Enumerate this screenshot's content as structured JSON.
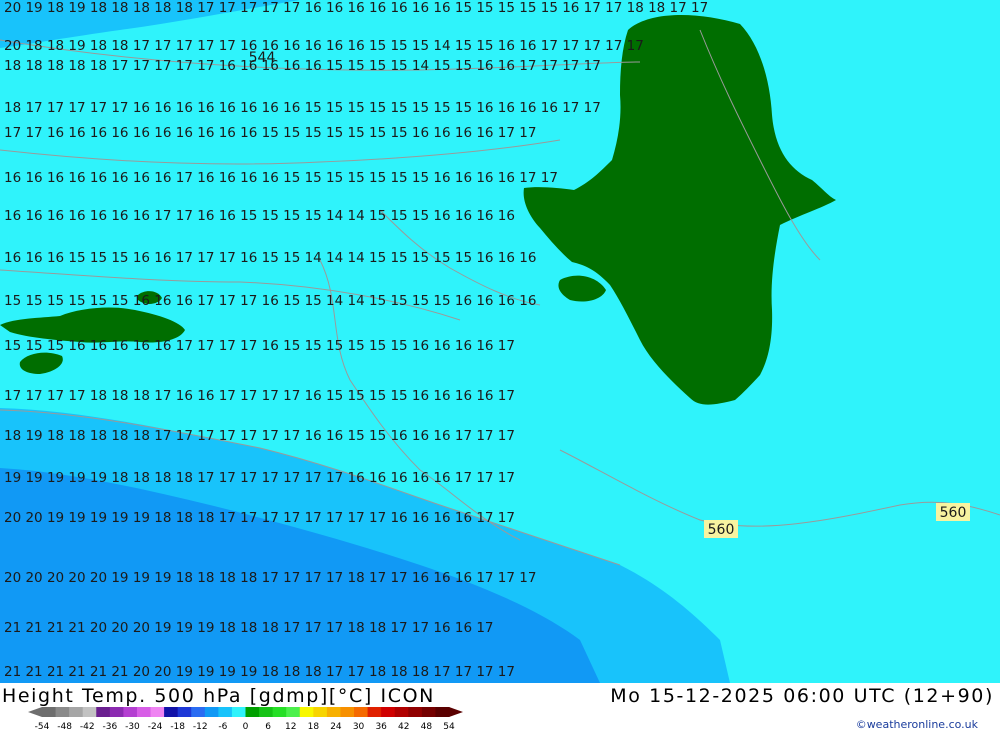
{
  "map": {
    "title_left": "Height Temp. 500 hPa [gdmp][°C] ICON",
    "title_right": "Mo 15-12-2025 06:00 UTC (12+90)",
    "credit": "©weatheronline.co.uk",
    "contour_labels": [
      "544",
      "560",
      "560"
    ],
    "temperature_labels_rows": [
      "20 19 18 19 18 18 18 18 18 17 17 17 17 17 16 16 16 16 16 16 16 15 15 15 15 15 16 17 17 18 18 17 17",
      "20 18 18 19 18 18 17 17 17 17 17 16 16 16 16 16 16 15 15 15 14 15 15 16 16 17 17 17 17 17",
      "18 18 18 18 18 17 17 17 17 17 16 16 16 16 16 15 15 15 15 14 15 15 16 16 17 17 17 17",
      "18 17 17 17 17 17 16 16 16 16 16 16 16 16 15 15 15 15 15 15 15 15 16 16 16 16 17 17",
      "17 17 16 16 16 16 16 16 16 16 16 16 15 15 15 15 15 15 15 16 16 16 16 17 17",
      "16 16 16 16 16 16 16 16 17 16 16 16 16 15 15 15 15 15 15 15 16 16 16 16 17 17",
      "16 16 16 16 16 16 16 17 17 16 16 15 15 15 15 14 14 15 15 15 16 16 16 16",
      "16 16 16 15 15 15 16 16 17 17 17 16 15 15 14 14 14 15 15 15 15 15 16 16 16",
      "15 15 15 15 15 15 16 16 16 17 17 17 16 15 15 14 14 15 15 15 15 16 16 16 16",
      "15 15 15 16 16 16 16 16 17 17 17 17 16 15 15 15 15 15 15 16 16 16 16 17",
      "17 17 17 17 18 18 18 17 16 16 17 17 17 17 16 15 15 15 15 16 16 16 16 17",
      "18 19 18 18 18 18 18 17 17 17 17 17 17 17 16 16 15 15 16 16 16 17 17 17",
      "19 19 19 19 19 18 18 18 18 17 17 17 17 17 17 17 16 16 16 16 16 17 17 17",
      "20 20 19 19 19 19 19 18 18 18 17 17 17 17 17 17 17 17 16 16 16 16 17 17",
      "20 20 20 20 20 19 19 19 18 18 18 18 17 17 17 17 18 17 17 16 16 16 17 17 17",
      "21 21 21 21 20 20 20 19 19 19 18 18 18 17 17 17 18 18 17 17 16 16 17",
      "21 21 21 21 21 21 20 20 19 19 19 19 18 18 18 17 17 18 18 18 17 17 17 17"
    ],
    "colors": {
      "land_cold_cyan": "#2ff3fb",
      "cold_blue_1": "#18c3fb",
      "cold_blue_2": "#1199f5",
      "warm_green": "#006e00",
      "contour_line": "#9a9a9a",
      "label_text": "#1a1a1a"
    }
  },
  "legend": {
    "ticks": [
      "-54",
      "-48",
      "-42",
      "-36",
      "-30",
      "-24",
      "-18",
      "-12",
      "-6",
      "0",
      "6",
      "12",
      "18",
      "24",
      "30",
      "36",
      "42",
      "48",
      "54"
    ],
    "colors": [
      "#6e6e6e",
      "#8a8a8a",
      "#a6a6a6",
      "#c2c2c2",
      "#6a1f8f",
      "#8c2bb1",
      "#b43fd1",
      "#d75ee6",
      "#ef83f2",
      "#1212a8",
      "#1e38d6",
      "#2a6cf2",
      "#1199f5",
      "#18c3fb",
      "#2ff3fb",
      "#00a000",
      "#16c316",
      "#26df26",
      "#4cf04c",
      "#f7f700",
      "#f7d400",
      "#f7b000",
      "#f79000",
      "#f56a00",
      "#e02000",
      "#d00000",
      "#b00000",
      "#900000",
      "#740000",
      "#5a0000"
    ]
  }
}
